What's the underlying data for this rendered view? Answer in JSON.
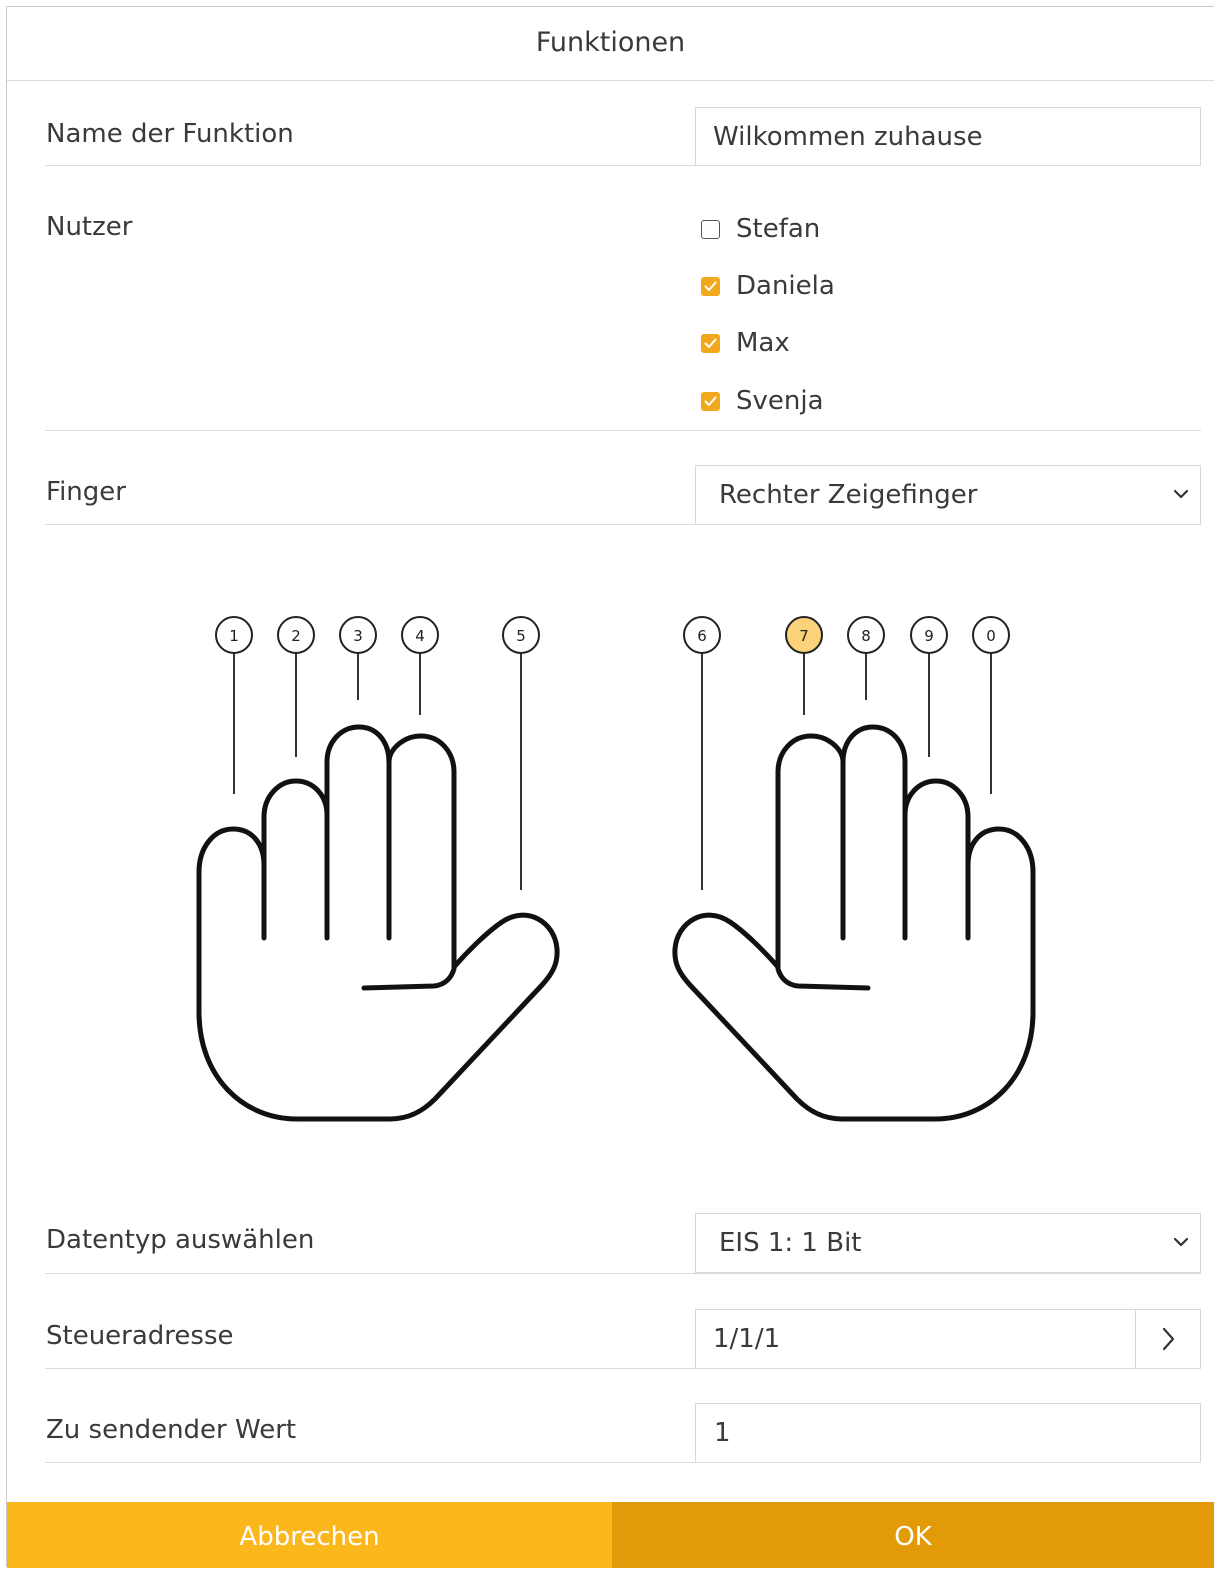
{
  "dialog": {
    "title": "Funktionen"
  },
  "name_field": {
    "label": "Name der Funktion",
    "value": "Wilkommen zuhause"
  },
  "users": {
    "label": "Nutzer",
    "items": [
      {
        "name": "Stefan",
        "checked": false
      },
      {
        "name": "Daniela",
        "checked": true
      },
      {
        "name": "Max",
        "checked": true
      },
      {
        "name": "Svenja",
        "checked": true
      }
    ]
  },
  "finger": {
    "label": "Finger",
    "selected": "Rechter Zeigefinger"
  },
  "finger_diagram": {
    "numbers": [
      "1",
      "2",
      "3",
      "4",
      "5",
      "6",
      "7",
      "8",
      "9",
      "0"
    ],
    "selected": "7"
  },
  "datatype": {
    "label": "Datentyp auswählen",
    "selected": "EIS 1: 1 Bit"
  },
  "address": {
    "label": "Steueradresse",
    "value": "1/1/1"
  },
  "send_value": {
    "label": "Zu sendender Wert",
    "value": "1"
  },
  "footer": {
    "cancel_label": "Abbrechen",
    "ok_label": "OK"
  },
  "colors": {
    "accent": "#f2a81d",
    "cancel_bg": "#fcb71c",
    "ok_bg": "#e39a08",
    "selected_finger": "#fbd27a"
  },
  "icons": {
    "dropdown": "chevron-down-icon",
    "navigate": "chevron-right-icon",
    "check": "check-icon"
  }
}
